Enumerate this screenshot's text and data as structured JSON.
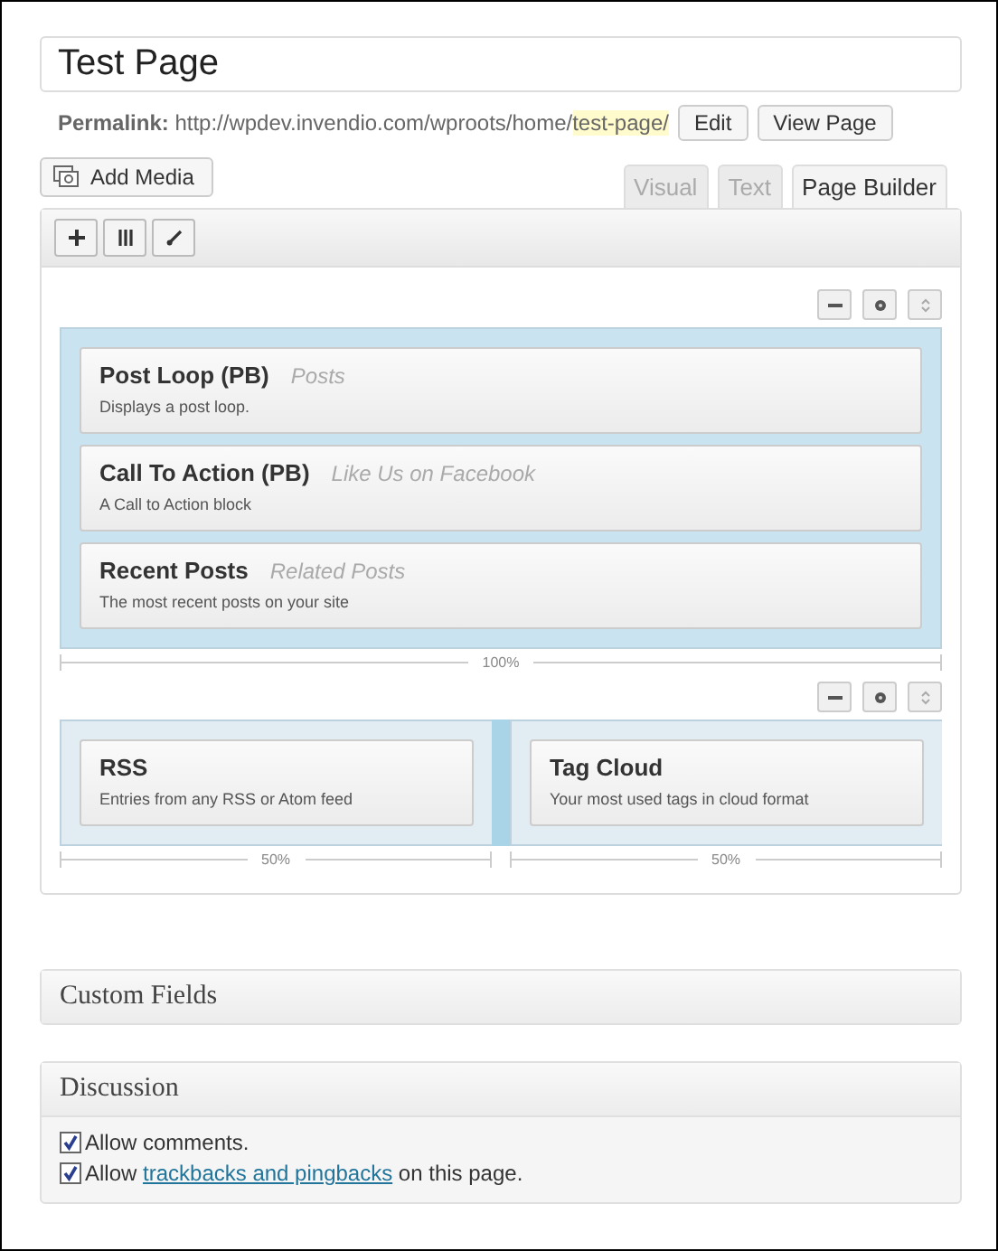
{
  "title_field": {
    "value": "Test Page"
  },
  "permalink": {
    "label": "Permalink:",
    "base": "http://wpdev.invendio.com/wproots/home/",
    "slug": "test-page/",
    "buttons": [
      "Edit",
      "View Page"
    ]
  },
  "add_media": {
    "label": "Add Media"
  },
  "editor_tabs": [
    {
      "label": "Visual",
      "selected": false
    },
    {
      "label": "Text",
      "selected": false
    },
    {
      "label": "Page Builder",
      "selected": true
    }
  ],
  "builder": {
    "toolbar": [
      {
        "kind": "add"
      },
      {
        "kind": "columns"
      },
      {
        "kind": "brush"
      }
    ],
    "rows": [
      {
        "cells": [
          {
            "width_label": "100%",
            "selected": true,
            "widgets": [
              {
                "title": "Post Loop (PB)",
                "subtitle": "Posts",
                "description": "Displays a post loop."
              },
              {
                "title": "Call To Action (PB)",
                "subtitle": "Like Us on Facebook",
                "description": "A Call to Action block"
              },
              {
                "title": "Recent Posts",
                "subtitle": "Related Posts",
                "description": "The most recent posts on your site"
              }
            ]
          }
        ]
      },
      {
        "cells": [
          {
            "width_label": "50%",
            "selected": false,
            "widgets": [
              {
                "title": "RSS",
                "description": "Entries from any RSS or Atom feed"
              }
            ]
          },
          {
            "width_label": "50%",
            "selected": false,
            "widgets": [
              {
                "title": "Tag Cloud",
                "description": "Your most used tags in cloud format"
              }
            ]
          }
        ]
      }
    ]
  },
  "custom_fields": {
    "title": "Custom Fields"
  },
  "discussion": {
    "title": "Discussion",
    "options": [
      {
        "checked": true,
        "text": "Allow comments."
      },
      {
        "checked": true,
        "text": "Allow ",
        "link": "trackbacks and pingbacks",
        "after": " on this page."
      }
    ]
  }
}
